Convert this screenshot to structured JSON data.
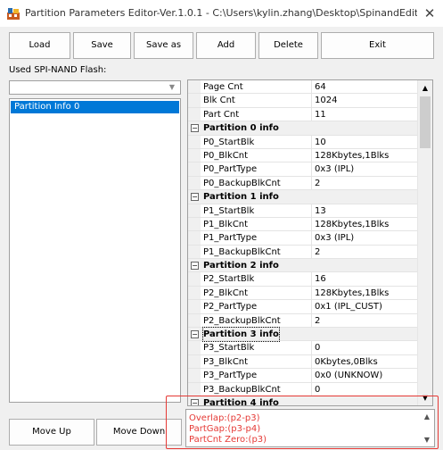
{
  "window": {
    "title": "Partition Parameters Editor-Ver.1.0.1 - C:\\Users\\kylin.zhang\\Desktop\\SpinandEdit...",
    "close": "✕"
  },
  "toolbar": {
    "load": "Load",
    "save": "Save",
    "save_as": "Save as",
    "add": "Add",
    "delete": "Delete",
    "exit": "Exit"
  },
  "left": {
    "used_label": "Used SPI-NAND Flash:",
    "combo_value": "",
    "list_items": [
      "Partition Info 0"
    ],
    "move_up": "Move Up",
    "move_down": "Move Down"
  },
  "grid": {
    "rows": [
      {
        "type": "prop",
        "key": "Page Cnt",
        "value": "64"
      },
      {
        "type": "prop",
        "key": "Blk Cnt",
        "value": "1024"
      },
      {
        "type": "prop",
        "key": "Part Cnt",
        "value": "11"
      },
      {
        "type": "header",
        "title": "Partition 0 info"
      },
      {
        "type": "prop",
        "key": "P0_StartBlk",
        "value": "10"
      },
      {
        "type": "prop",
        "key": "P0_BlkCnt",
        "value": "128Kbytes,1Blks"
      },
      {
        "type": "prop",
        "key": "P0_PartType",
        "value": "0x3 (IPL)"
      },
      {
        "type": "prop",
        "key": "P0_BackupBlkCnt",
        "value": "2"
      },
      {
        "type": "header",
        "title": "Partition 1 info"
      },
      {
        "type": "prop",
        "key": "P1_StartBlk",
        "value": "13"
      },
      {
        "type": "prop",
        "key": "P1_BlkCnt",
        "value": "128Kbytes,1Blks"
      },
      {
        "type": "prop",
        "key": "P1_PartType",
        "value": "0x3 (IPL)"
      },
      {
        "type": "prop",
        "key": "P1_BackupBlkCnt",
        "value": "2"
      },
      {
        "type": "header",
        "title": "Partition 2 info"
      },
      {
        "type": "prop",
        "key": "P2_StartBlk",
        "value": "16"
      },
      {
        "type": "prop",
        "key": "P2_BlkCnt",
        "value": "128Kbytes,1Blks"
      },
      {
        "type": "prop",
        "key": "P2_PartType",
        "value": "0x1 (IPL_CUST)"
      },
      {
        "type": "prop",
        "key": "P2_BackupBlkCnt",
        "value": "2"
      },
      {
        "type": "header",
        "title": "Partition 3 info",
        "selected": true
      },
      {
        "type": "prop",
        "key": "P3_StartBlk",
        "value": "0"
      },
      {
        "type": "prop",
        "key": "P3_BlkCnt",
        "value": "0Kbytes,0Blks"
      },
      {
        "type": "prop",
        "key": "P3_PartType",
        "value": "0x0 (UNKNOW)"
      },
      {
        "type": "prop",
        "key": "P3_BackupBlkCnt",
        "value": "0"
      },
      {
        "type": "header",
        "title": "Partition 4 info"
      }
    ]
  },
  "messages": [
    "Overlap:(p2-p3)",
    "PartGap:(p3-p4)",
    "PartCnt Zero:(p3)"
  ],
  "colors": {
    "selection": "#0078d7",
    "error_text": "#e53935",
    "highlight_box": "#e53935"
  }
}
